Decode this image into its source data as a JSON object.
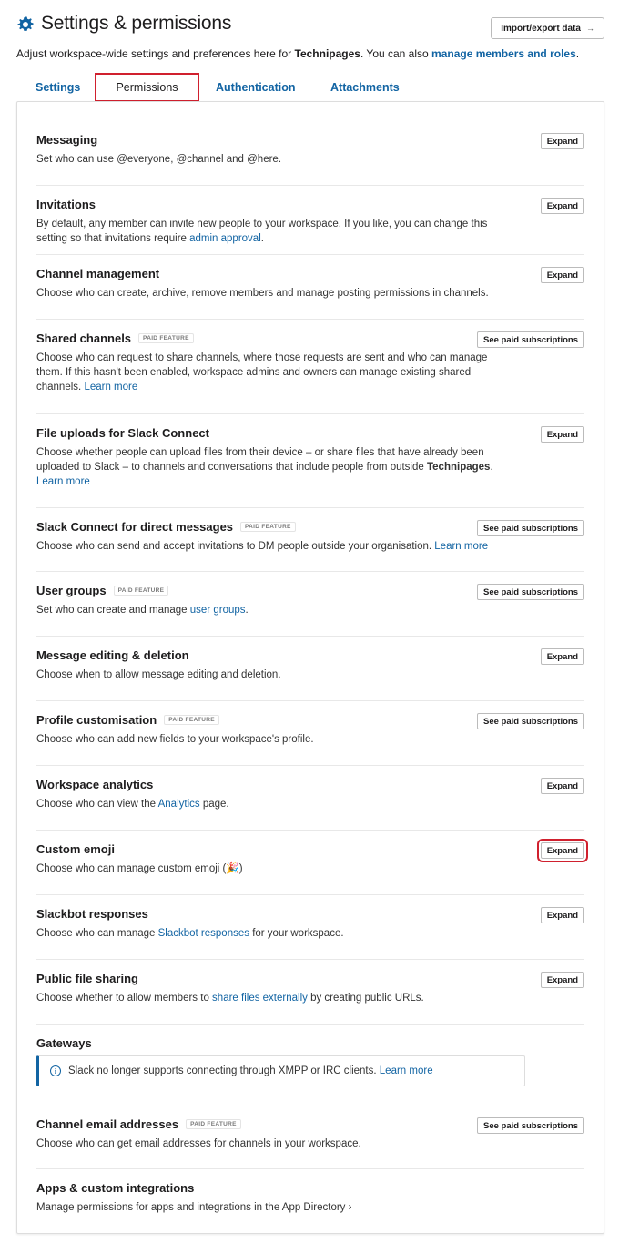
{
  "header": {
    "title": "Settings & permissions",
    "import_button": "Import/export data",
    "import_arrow": "→"
  },
  "subtitle": {
    "prefix": "Adjust workspace-wide settings and preferences here for ",
    "workspace": "Technipages",
    "middle": ". You can also ",
    "link": "manage members and roles",
    "suffix": "."
  },
  "tabs": [
    {
      "label": "Settings"
    },
    {
      "label": "Permissions",
      "active": true
    },
    {
      "label": "Authentication"
    },
    {
      "label": "Attachments"
    }
  ],
  "badge_label": "PAID FEATURE",
  "sections": {
    "messaging": {
      "title": "Messaging",
      "desc": "Set who can use @everyone, @channel and @here.",
      "button": "Expand"
    },
    "invitations": {
      "title": "Invitations",
      "desc_a": "By default, any member can invite new people to your workspace. If you like, you can change this setting so that invitations require ",
      "link": "admin approval",
      "desc_b": ".",
      "button": "Expand"
    },
    "channel_mgmt": {
      "title": "Channel management",
      "desc": "Choose who can create, archive, remove members and manage posting permissions in channels.",
      "button": "Expand"
    },
    "shared_channels": {
      "title": "Shared channels",
      "desc_a": "Choose who can request to share channels, where those requests are sent and who can manage them. If this hasn't been enabled, workspace admins and owners can manage existing shared channels. ",
      "link": "Learn more",
      "button": "See paid subscriptions"
    },
    "file_uploads": {
      "title": "File uploads for Slack Connect",
      "desc_a": "Choose whether people can upload files from their device – or share files that have already been uploaded to Slack – to channels and conversations that include people from outside ",
      "bold": "Technipages",
      "desc_b": ". ",
      "link": "Learn more",
      "button": "Expand"
    },
    "slack_connect_dm": {
      "title": "Slack Connect for direct messages",
      "desc_a": "Choose who can send and accept invitations to DM people outside your organisation. ",
      "link": "Learn more",
      "button": "See paid subscriptions"
    },
    "user_groups": {
      "title": "User groups",
      "desc_a": "Set who can create and manage ",
      "link": "user groups",
      "desc_b": ".",
      "button": "See paid subscriptions"
    },
    "message_editing": {
      "title": "Message editing & deletion",
      "desc": "Choose when to allow message editing and deletion.",
      "button": "Expand"
    },
    "profile": {
      "title": "Profile customisation",
      "desc": "Choose who can add new fields to your workspace's profile.",
      "button": "See paid subscriptions"
    },
    "analytics": {
      "title": "Workspace analytics",
      "desc_a": "Choose who can view the ",
      "link": "Analytics",
      "desc_b": " page.",
      "button": "Expand"
    },
    "custom_emoji": {
      "title": "Custom emoji",
      "desc": "Choose who can manage custom emoji (🎉)",
      "button": "Expand"
    },
    "slackbot": {
      "title": "Slackbot responses",
      "desc_a": "Choose who can manage ",
      "link": "Slackbot responses",
      "desc_b": " for your workspace.",
      "button": "Expand"
    },
    "public_file": {
      "title": "Public file sharing",
      "desc_a": "Choose whether to allow members to ",
      "link": "share files externally",
      "desc_b": " by creating public URLs.",
      "button": "Expand"
    },
    "gateways": {
      "title": "Gateways",
      "notice_a": "Slack no longer supports connecting through XMPP or IRC clients. ",
      "link": "Learn more",
      "icon": "info-icon"
    },
    "channel_email": {
      "title": "Channel email addresses",
      "desc": "Choose who can get email addresses for channels in your workspace.",
      "button": "See paid subscriptions"
    },
    "apps": {
      "title": "Apps & custom integrations",
      "link": "Manage permissions for apps and integrations in the App Directory ›"
    }
  },
  "colors": {
    "accent": "#1264a3",
    "highlight": "#d0202e",
    "gear": "#1264a3"
  }
}
